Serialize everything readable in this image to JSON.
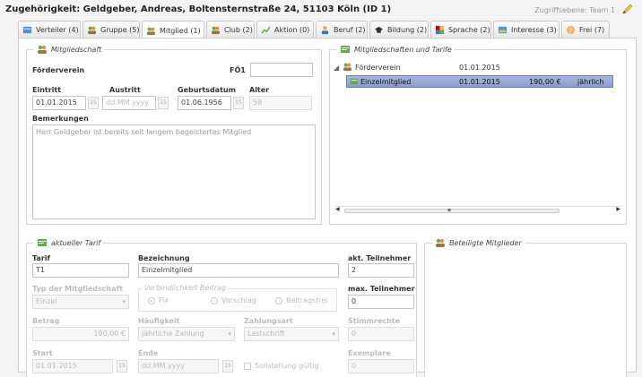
{
  "header": {
    "title": "Zugehörigkeit:  Geldgeber, Andreas, Boltensternstraße 24, 51103 Köln (ID 1)",
    "access": "Zugriffsebene: Team 1"
  },
  "tabs": [
    {
      "label": "Verteiler (4)"
    },
    {
      "label": "Gruppe (5)"
    },
    {
      "label": "Mitglied (1)"
    },
    {
      "label": "Club (2)"
    },
    {
      "label": "Aktion (0)"
    },
    {
      "label": "Beruf (2)"
    },
    {
      "label": "Bildung (2)"
    },
    {
      "label": "Sprache (2)"
    },
    {
      "label": "Interesse (3)"
    },
    {
      "label": "Frei (7)"
    }
  ],
  "mitgliedschaft": {
    "legend": "Mitgliedschaft",
    "foerderverein_label": "Förderverein",
    "foe1_label": "FÖ1",
    "foe1_value": "",
    "eintritt_label": "Eintritt",
    "eintritt_value": "01.01.2015",
    "austritt_label": "Austritt",
    "austritt_placeholder": "dd.MM.yyyy",
    "geburtsdatum_label": "Geburtsdatum",
    "geburtsdatum_value": "01.06.1956",
    "alter_label": "Alter",
    "alter_value": "59",
    "bemerkungen_label": "Bemerkungen",
    "bemerkungen_value": "Herr Geldgeber ist bereits seit langem begeistertes Mitglied"
  },
  "tarife": {
    "legend": "Mitgliedschaften und Tarife",
    "tree": [
      {
        "name": "Förderverein",
        "date": "01.01.2015",
        "amount": "",
        "freq": ""
      },
      {
        "name": "Einzelmitglied",
        "date": "01.01.2015",
        "amount": "190,00 €",
        "freq": "jährlich"
      }
    ]
  },
  "aktueller_tarif": {
    "legend": "aktueller Tarif",
    "tarif_label": "Tarif",
    "tarif_value": "T1",
    "bezeichnung_label": "Bezeichnung",
    "bezeichnung_value": "Einzelmitglied",
    "akt_teilnehmer_label": "akt. Teilnehmer",
    "akt_teilnehmer_value": "2",
    "typ_label": "Typ der Mitgliedschaft",
    "typ_value": "Einzel",
    "verbindlichkeit_label": "Verbindlichkeit Beitrag",
    "radio_fix": "Fix",
    "radio_vorschlag": "Vorschlag",
    "radio_beitragsfrei": "Beitragsfrei",
    "max_teilnehmer_label": "max. Teilnehmer",
    "max_teilnehmer_value": "0",
    "betrag_label": "Betrag",
    "betrag_value": "190,00 €",
    "haeufigkeit_label": "Häufigkeit",
    "haeufigkeit_value": "jährliche Zahlung",
    "zahlungsart_label": "Zahlungsart",
    "zahlungsart_value": "Lastschrift",
    "stimmrechte_label": "Stimmrechte",
    "stimmrechte_value": "0",
    "start_label": "Start",
    "start_value": "01.01.2015",
    "ende_label": "Ende",
    "ende_placeholder": "dd.MM.yyyy",
    "solo_label": "Solistellung gültig",
    "exemplare_label": "Exemplare",
    "exemplare_value": "0"
  },
  "beteiligte": {
    "legend": "Beteiligte Mitglieder"
  },
  "colors": {
    "selection": "#8b9bd0",
    "border": "#d6d6d6"
  }
}
